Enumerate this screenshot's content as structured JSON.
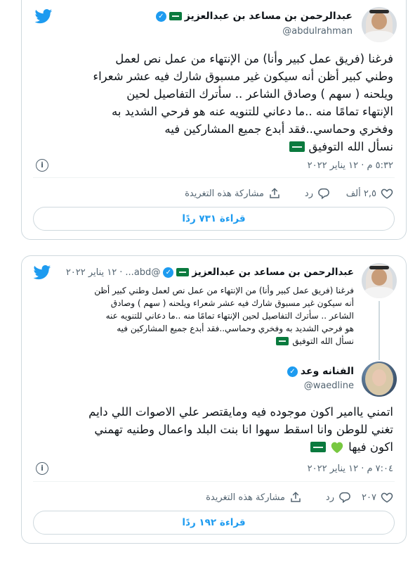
{
  "tweet1": {
    "author_name": "عبدالرحمن بن مساعد بن عبدالعزيز",
    "author_handle": "@abdulrahman",
    "text_lines": [
      "فرغنا (فريق عمل كبير وأنا) من الإنتهاء من عمل نص لعمل",
      "وطني كبير أظن أنه سيكون غير مسبوق شارك فيه عشر شعراء",
      "ويلحنه ( سهم ) وصادق الشاعر .. سأترك التفاصيل لحين",
      "الإنتهاء تمامًا منه ..ما دعاني للتنويه عنه هو فرحي الشديد به",
      "وفخري وحماسي..فقد أبدع جميع المشاركين فيه",
      "نسأل الله التوفيق"
    ],
    "timestamp": "٥:٣٢ م · ١٢ يناير ٢٠٢٢",
    "likes": "٢,٥ ألف",
    "reply_label": "رد",
    "share_label": "مشاركة هذه التغريدة",
    "read_replies": "قراءة ٧٣١ ردًا"
  },
  "tweet2": {
    "quoted": {
      "author_name": "عبدالرحمن بن مساعد بن عبدالعزيز",
      "author_handle": "@abd...",
      "date": "١٢ يناير ٢٠٢٢",
      "text_lines": [
        "فرغنا (فريق عمل كبير وأنا) من الإنتهاء من عمل نص لعمل وطني كبير أظن",
        "أنه سيكون غير مسبوق شارك فيه عشر شعراء ويلحنه ( سهم ) وصادق",
        "الشاعر .. سأترك التفاصيل لحين الإنتهاء تمامًا منه ..ما دعاني للتنويه عنه",
        "هو فرحي الشديد به وفخري وحماسي..فقد أبدع جميع المشاركين فيه",
        "نسأل الله التوفيق"
      ]
    },
    "author_name": "الفنانه وعد",
    "author_handle": "@waedline",
    "text_lines": [
      "اتمني ياامير اكون موجوده فيه ومايقتصر علي الاصوات اللي دايم",
      "تغني للوطن وانا اسقط سهوا انا بنت البلد واعمال وطنيه تهمني",
      "اكون فيها"
    ],
    "timestamp": "٧:٠٤ م · ١٢ يناير ٢٠٢٢",
    "likes": "٢٠٧",
    "reply_label": "رد",
    "share_label": "مشاركة هذه التغريدة",
    "read_replies": "قراءة ١٩٢ ردًا"
  },
  "icons": {
    "verified": "verified-badge-icon",
    "flag": "saudi-flag-emoji",
    "bird": "twitter-bird-icon",
    "heart": "green-heart-emoji"
  },
  "colors": {
    "accent": "#1d9bf0",
    "text": "#0f1419",
    "muted": "#536471",
    "border": "#cfd9de",
    "flag_green": "#0a7a3e",
    "heart_green": "#78c841"
  }
}
